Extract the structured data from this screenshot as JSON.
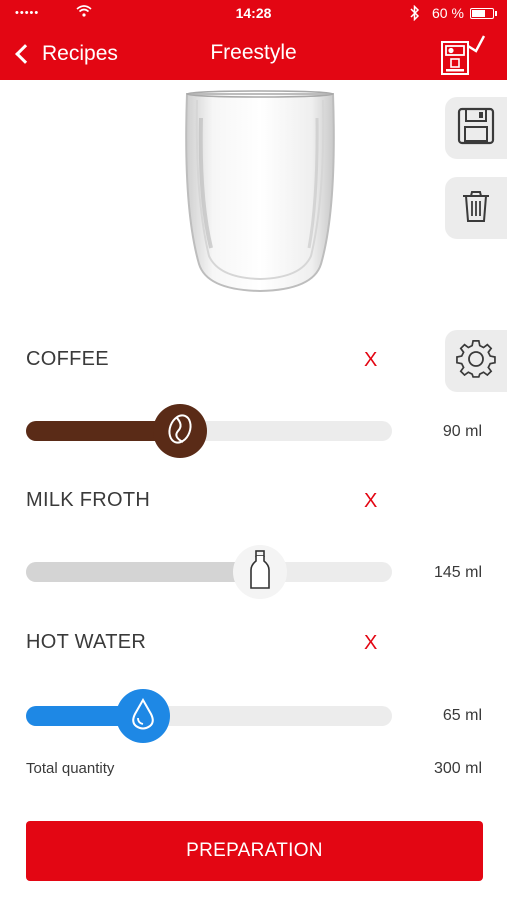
{
  "status_bar": {
    "signal": "•••••",
    "time": "14:28",
    "battery_percent": "60 %",
    "icons": [
      "wifi-icon",
      "bluetooth-icon",
      "battery-icon"
    ]
  },
  "nav": {
    "back_label": "Recipes",
    "title": "Freestyle",
    "machine_icon": "coffee-machine-check-icon"
  },
  "side_actions": [
    "save-icon",
    "trash-icon",
    "gear-icon"
  ],
  "ingredients": [
    {
      "name": "COFFEE",
      "remove_label": "X",
      "amount": "90 ml",
      "slider_fraction": 0.42,
      "color": "#5a2b17",
      "icon": "coffee-bean-icon"
    },
    {
      "name": "MILK FROTH",
      "remove_label": "X",
      "amount": "145 ml",
      "slider_fraction": 0.64,
      "color": "#d4d4d4",
      "icon": "milk-bottle-icon"
    },
    {
      "name": "HOT WATER",
      "remove_label": "X",
      "amount": "65 ml",
      "slider_fraction": 0.32,
      "color": "#1e88e5",
      "icon": "water-drop-icon"
    }
  ],
  "total": {
    "label": "Total quantity",
    "value": "300 ml"
  },
  "primary_action": {
    "label": "PREPARATION"
  },
  "colors": {
    "brand_red": "#e30613",
    "coffee": "#5a2b17",
    "water": "#1e88e5",
    "milk": "#d4d4d4",
    "track": "#ececec"
  }
}
